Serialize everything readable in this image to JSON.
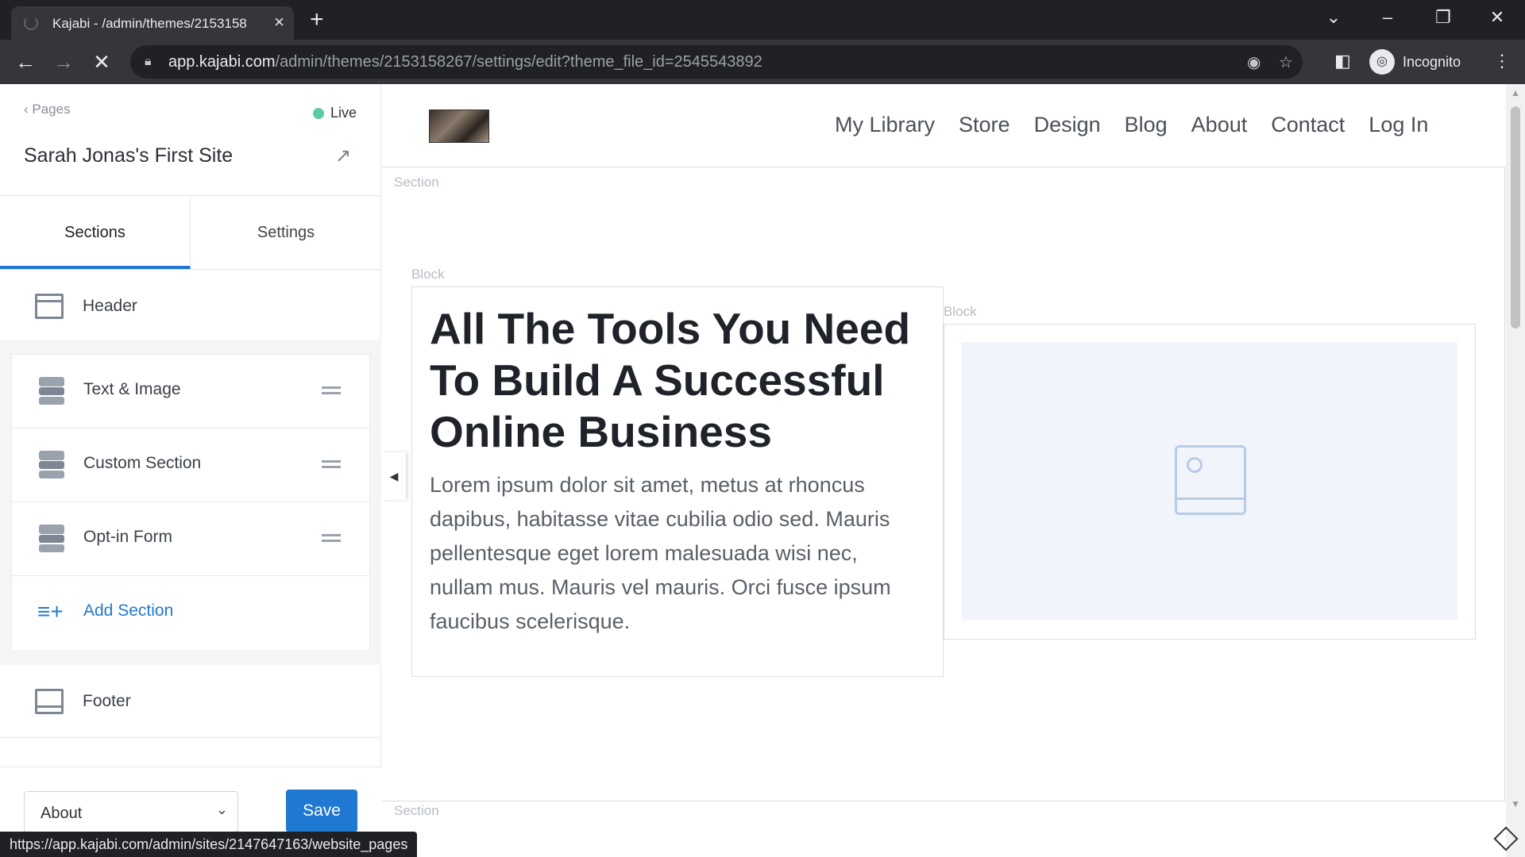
{
  "browser": {
    "tab_title": "Kajabi - /admin/themes/2153158",
    "url_host": "app.kajabi.com",
    "url_path": "/admin/themes/2153158267/settings/edit?theme_file_id=2545543892",
    "incognito_label": "Incognito",
    "status_url": "https://app.kajabi.com/admin/sites/2147647163/website_pages"
  },
  "sidebar": {
    "back_label": "Pages",
    "live_label": "Live",
    "site_title": "Sarah Jonas's First Site",
    "tabs": [
      "Sections",
      "Settings"
    ],
    "header_label": "Header",
    "sections": [
      "Text & Image",
      "Custom Section",
      "Opt-in Form"
    ],
    "add_section": "Add Section",
    "footer_label": "Footer",
    "page_select": "About",
    "save_label": "Save"
  },
  "preview": {
    "nav": [
      "My Library",
      "Store",
      "Design",
      "Blog",
      "About",
      "Contact",
      "Log In"
    ],
    "section_tag": "Section",
    "block_tag": "Block",
    "headline": "All The Tools You Need To Build A Successful Online Business",
    "body": "Lorem ipsum dolor sit amet, metus at rhoncus dapibus, habitasse vitae cubilia odio sed. Mauris pellentesque eget lorem malesuada wisi nec, nullam mus. Mauris vel mauris. Orci fusce ipsum faucibus scelerisque."
  }
}
